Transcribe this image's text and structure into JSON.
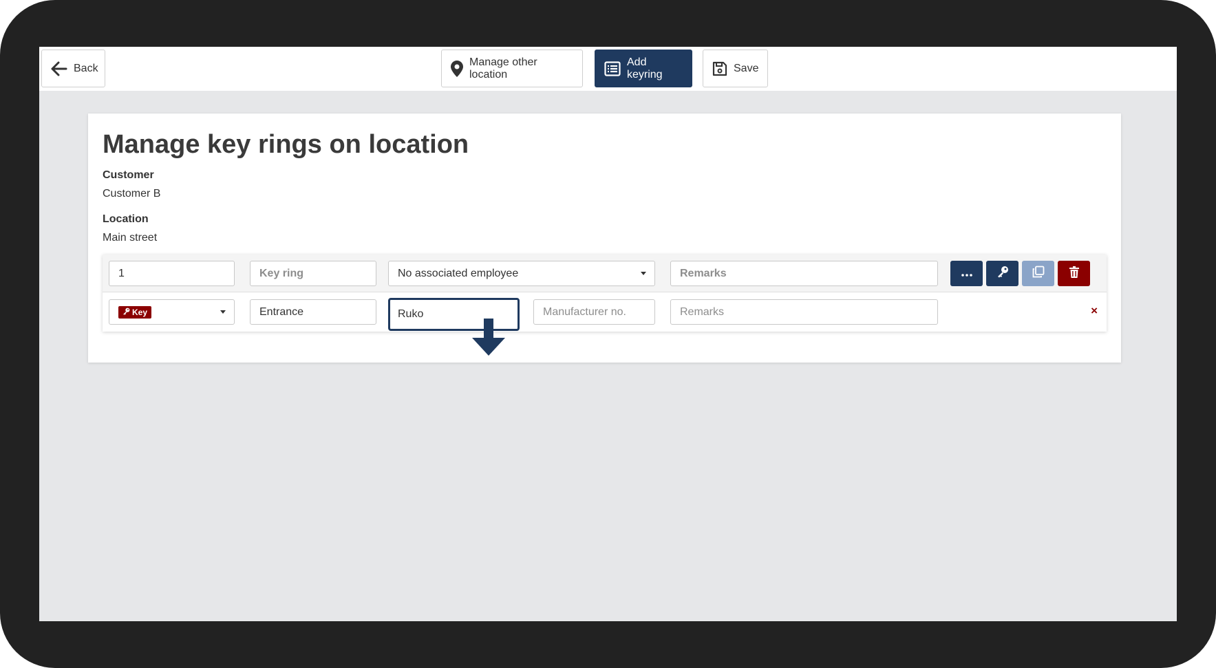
{
  "toolbar": {
    "back_label": "Back",
    "manage_location_label": "Manage other location",
    "add_keyring_label": "Add keyring",
    "save_label": "Save"
  },
  "page": {
    "title": "Manage key rings on location",
    "customer_label": "Customer",
    "customer_value": "Customer B",
    "location_label": "Location",
    "location_value": "Main street"
  },
  "keyring": {
    "number": "1",
    "name_placeholder": "Key ring",
    "employee_selected": "No associated employee",
    "remarks_placeholder": "Remarks",
    "actions": [
      "more-options",
      "key",
      "copy",
      "delete"
    ],
    "key_row": {
      "type_badge": "Key",
      "name": "Entrance",
      "brand": "Ruko",
      "manufacturer_placeholder": "Manufacturer no.",
      "remarks_placeholder": "Remarks",
      "remove_symbol": "×"
    }
  },
  "colors": {
    "primary": "#1f3a5f",
    "danger": "#8b0000",
    "disabled_primary": "#8aa4c8",
    "background": "#e6e7e9",
    "frame": "#222222"
  }
}
